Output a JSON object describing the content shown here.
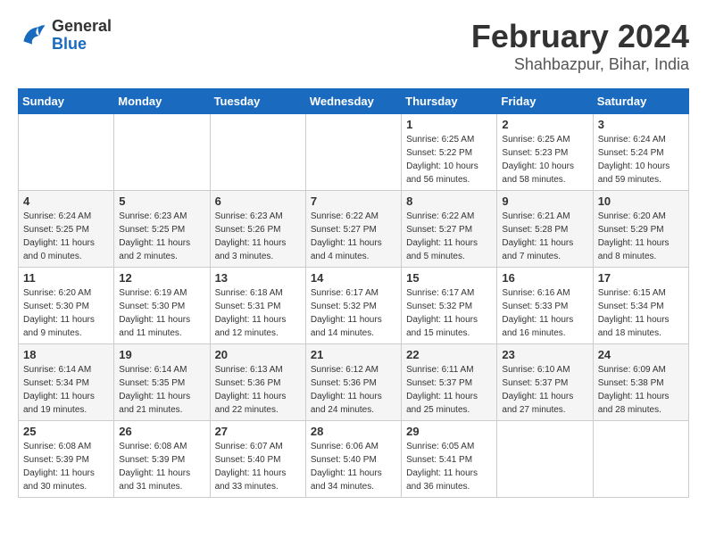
{
  "header": {
    "logo": {
      "line1": "General",
      "line2": "Blue"
    },
    "title": "February 2024",
    "location": "Shahbazpur, Bihar, India"
  },
  "weekdays": [
    "Sunday",
    "Monday",
    "Tuesday",
    "Wednesday",
    "Thursday",
    "Friday",
    "Saturday"
  ],
  "weeks": [
    [
      {
        "day": "",
        "info": ""
      },
      {
        "day": "",
        "info": ""
      },
      {
        "day": "",
        "info": ""
      },
      {
        "day": "",
        "info": ""
      },
      {
        "day": "1",
        "info": "Sunrise: 6:25 AM\nSunset: 5:22 PM\nDaylight: 10 hours\nand 56 minutes."
      },
      {
        "day": "2",
        "info": "Sunrise: 6:25 AM\nSunset: 5:23 PM\nDaylight: 10 hours\nand 58 minutes."
      },
      {
        "day": "3",
        "info": "Sunrise: 6:24 AM\nSunset: 5:24 PM\nDaylight: 10 hours\nand 59 minutes."
      }
    ],
    [
      {
        "day": "4",
        "info": "Sunrise: 6:24 AM\nSunset: 5:25 PM\nDaylight: 11 hours\nand 0 minutes."
      },
      {
        "day": "5",
        "info": "Sunrise: 6:23 AM\nSunset: 5:25 PM\nDaylight: 11 hours\nand 2 minutes."
      },
      {
        "day": "6",
        "info": "Sunrise: 6:23 AM\nSunset: 5:26 PM\nDaylight: 11 hours\nand 3 minutes."
      },
      {
        "day": "7",
        "info": "Sunrise: 6:22 AM\nSunset: 5:27 PM\nDaylight: 11 hours\nand 4 minutes."
      },
      {
        "day": "8",
        "info": "Sunrise: 6:22 AM\nSunset: 5:27 PM\nDaylight: 11 hours\nand 5 minutes."
      },
      {
        "day": "9",
        "info": "Sunrise: 6:21 AM\nSunset: 5:28 PM\nDaylight: 11 hours\nand 7 minutes."
      },
      {
        "day": "10",
        "info": "Sunrise: 6:20 AM\nSunset: 5:29 PM\nDaylight: 11 hours\nand 8 minutes."
      }
    ],
    [
      {
        "day": "11",
        "info": "Sunrise: 6:20 AM\nSunset: 5:30 PM\nDaylight: 11 hours\nand 9 minutes."
      },
      {
        "day": "12",
        "info": "Sunrise: 6:19 AM\nSunset: 5:30 PM\nDaylight: 11 hours\nand 11 minutes."
      },
      {
        "day": "13",
        "info": "Sunrise: 6:18 AM\nSunset: 5:31 PM\nDaylight: 11 hours\nand 12 minutes."
      },
      {
        "day": "14",
        "info": "Sunrise: 6:17 AM\nSunset: 5:32 PM\nDaylight: 11 hours\nand 14 minutes."
      },
      {
        "day": "15",
        "info": "Sunrise: 6:17 AM\nSunset: 5:32 PM\nDaylight: 11 hours\nand 15 minutes."
      },
      {
        "day": "16",
        "info": "Sunrise: 6:16 AM\nSunset: 5:33 PM\nDaylight: 11 hours\nand 16 minutes."
      },
      {
        "day": "17",
        "info": "Sunrise: 6:15 AM\nSunset: 5:34 PM\nDaylight: 11 hours\nand 18 minutes."
      }
    ],
    [
      {
        "day": "18",
        "info": "Sunrise: 6:14 AM\nSunset: 5:34 PM\nDaylight: 11 hours\nand 19 minutes."
      },
      {
        "day": "19",
        "info": "Sunrise: 6:14 AM\nSunset: 5:35 PM\nDaylight: 11 hours\nand 21 minutes."
      },
      {
        "day": "20",
        "info": "Sunrise: 6:13 AM\nSunset: 5:36 PM\nDaylight: 11 hours\nand 22 minutes."
      },
      {
        "day": "21",
        "info": "Sunrise: 6:12 AM\nSunset: 5:36 PM\nDaylight: 11 hours\nand 24 minutes."
      },
      {
        "day": "22",
        "info": "Sunrise: 6:11 AM\nSunset: 5:37 PM\nDaylight: 11 hours\nand 25 minutes."
      },
      {
        "day": "23",
        "info": "Sunrise: 6:10 AM\nSunset: 5:37 PM\nDaylight: 11 hours\nand 27 minutes."
      },
      {
        "day": "24",
        "info": "Sunrise: 6:09 AM\nSunset: 5:38 PM\nDaylight: 11 hours\nand 28 minutes."
      }
    ],
    [
      {
        "day": "25",
        "info": "Sunrise: 6:08 AM\nSunset: 5:39 PM\nDaylight: 11 hours\nand 30 minutes."
      },
      {
        "day": "26",
        "info": "Sunrise: 6:08 AM\nSunset: 5:39 PM\nDaylight: 11 hours\nand 31 minutes."
      },
      {
        "day": "27",
        "info": "Sunrise: 6:07 AM\nSunset: 5:40 PM\nDaylight: 11 hours\nand 33 minutes."
      },
      {
        "day": "28",
        "info": "Sunrise: 6:06 AM\nSunset: 5:40 PM\nDaylight: 11 hours\nand 34 minutes."
      },
      {
        "day": "29",
        "info": "Sunrise: 6:05 AM\nSunset: 5:41 PM\nDaylight: 11 hours\nand 36 minutes."
      },
      {
        "day": "",
        "info": ""
      },
      {
        "day": "",
        "info": ""
      }
    ]
  ]
}
